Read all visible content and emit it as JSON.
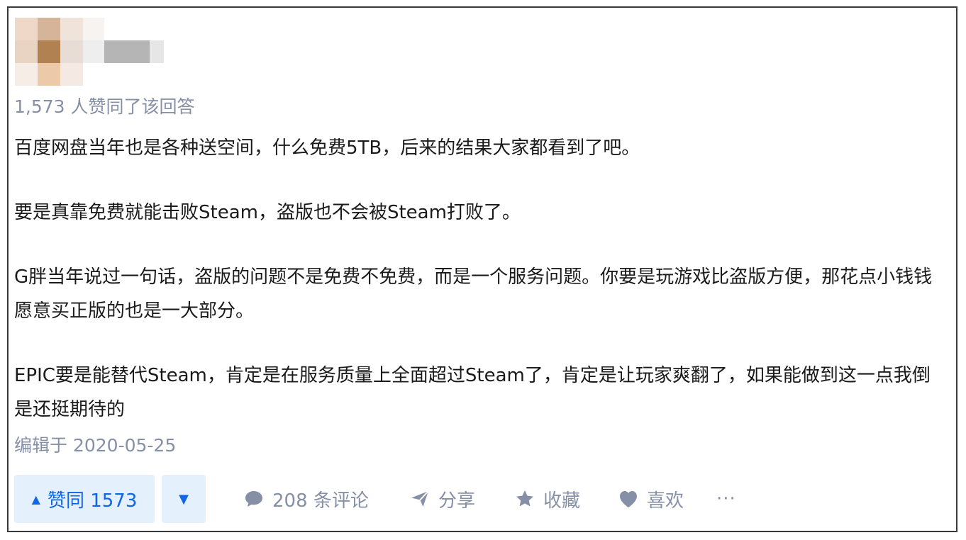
{
  "answer": {
    "likes_text": "1,573 人赞同了该回答",
    "paragraphs": [
      "百度网盘当年也是各种送空间，什么免费5TB，后来的结果大家都看到了吧。",
      "要是真靠免费就能击败Steam，盗版也不会被Steam打败了。",
      "G胖当年说过一句话，盗版的问题不是免费不免费，而是一个服务问题。你要是玩游戏比盗版方便，那花点小钱钱愿意买正版的也是一大部分。",
      "EPIC要是能替代Steam，肯定是在服务质量上全面超过Steam了，肯定是让玩家爽翻了，如果能做到这一点我倒是还挺期待的"
    ],
    "edited_text": "编辑于 2020-05-25"
  },
  "actions": {
    "vote_up_label": "赞同 1573",
    "comments_label": "208 条评论",
    "share_label": "分享",
    "collect_label": "收藏",
    "like_label": "喜欢",
    "more_label": "···"
  },
  "colors": {
    "accent": "#0e66e7",
    "accent_bg": "#e5f0fd",
    "muted": "#8590a6",
    "text": "#1a1a1a"
  },
  "icons": [
    "triangle-up-icon",
    "triangle-down-icon",
    "comment-icon",
    "share-icon",
    "star-icon",
    "heart-icon",
    "more-icon"
  ]
}
